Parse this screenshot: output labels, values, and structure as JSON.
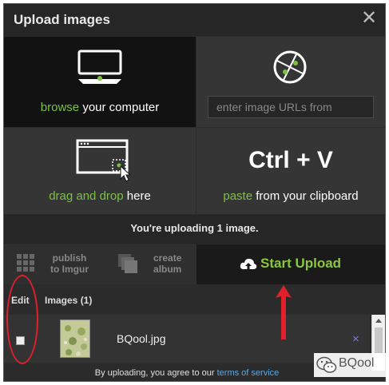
{
  "dialog": {
    "title": "Upload images",
    "close_icon": "close-icon"
  },
  "tiles": {
    "browse": {
      "highlight": "browse",
      "rest": " your computer",
      "icon": "monitor-icon"
    },
    "url": {
      "placeholder": "enter image URLs from",
      "icon": "globe-icon"
    },
    "drag": {
      "highlight": "drag and drop",
      "rest": " here",
      "icon": "drag-drop-window-icon"
    },
    "paste": {
      "shortcut": "Ctrl + V",
      "highlight": "paste",
      "rest": " from your clipboard"
    }
  },
  "status_text": "You're uploading 1 image.",
  "actions": {
    "publish": {
      "line1": "publish",
      "line2": "to Imgur",
      "icon": "grid-icon"
    },
    "album": {
      "line1": "create",
      "line2": "album",
      "icon": "stack-icon"
    },
    "start": {
      "label": "Start Upload",
      "icon": "cloud-upload-icon"
    }
  },
  "list": {
    "edit_header": "Edit",
    "images_header": "Images (1)",
    "items": [
      {
        "filename": "BQool.jpg",
        "remove_label": "×",
        "checked": false
      }
    ]
  },
  "footer": {
    "text": "By uploading, you agree to our ",
    "link": "terms of service"
  },
  "watermark": {
    "text": "BQool",
    "icon": "wechat-icon"
  },
  "colors": {
    "accent_green": "#8cc63f",
    "link_blue": "#5aa8e0",
    "annotation_red": "#e0202a",
    "background": "#2b2b2b"
  }
}
